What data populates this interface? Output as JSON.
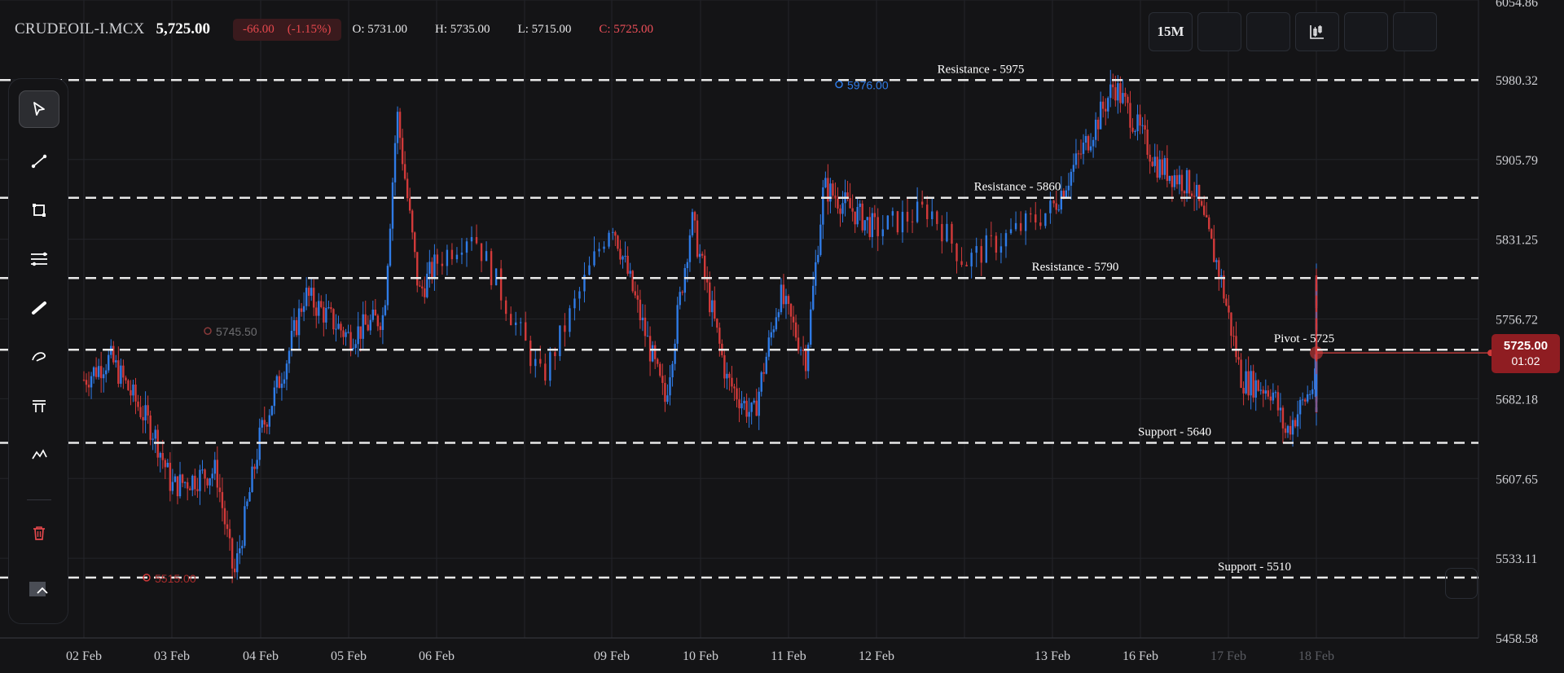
{
  "header": {
    "symbol": "CRUDEOIL-I.MCX",
    "price": "5,725.00",
    "change": "-66.00",
    "change_pct": "(-1.15%)",
    "open": "O: 5731.00",
    "high": "H: 5735.00",
    "low": "L: 5715.00",
    "close": "C: 5725.00"
  },
  "top_toolbar": {
    "interval_label": "15M",
    "buttons": [
      {
        "icon": "interval-button"
      },
      {
        "icon": "blank-button"
      },
      {
        "icon": "blank-button"
      },
      {
        "icon": "indicators-icon"
      },
      {
        "icon": "blank-button"
      },
      {
        "icon": "blank-button"
      }
    ]
  },
  "left_toolbar": {
    "tools": [
      {
        "name": "cursor",
        "icon": "cursor-arrow-icon",
        "active": true
      },
      {
        "name": "trend-line",
        "icon": "trend-line-icon"
      },
      {
        "name": "rectangle",
        "icon": "rectangle-icon"
      },
      {
        "name": "parallel-lines",
        "icon": "parallel-lines-icon"
      },
      {
        "name": "brush",
        "icon": "brush-icon"
      },
      {
        "name": "freehand",
        "icon": "freehand-icon"
      },
      {
        "name": "fibonacci",
        "icon": "fib-icon"
      },
      {
        "name": "path",
        "icon": "path-icon"
      },
      {
        "name": "delete",
        "icon": "trash-icon"
      },
      {
        "name": "collapse",
        "icon": "chevron-up-icon"
      }
    ]
  },
  "price_tag": {
    "value": "5725.00",
    "countdown": "01:02"
  },
  "colors": {
    "background": "#141416",
    "up": "#2f7be6",
    "down": "#d23a3a",
    "grid": "#232429",
    "level_line": "#e8e8e8",
    "price_line": "#b83b3b",
    "accent_red": "#e5484d"
  },
  "chart_data": {
    "type": "candlestick",
    "y_axis": {
      "ticks": [
        5458.58,
        5533.11,
        5607.65,
        5682.18,
        5756.72,
        5831.25,
        5905.79,
        5980.32,
        6054.86
      ],
      "tick_labels": [
        "5458.58",
        "5533.11",
        "5607.65",
        "5682.18",
        "5756.72",
        "5831.25",
        "5905.79",
        "5980.32",
        "6054.86"
      ],
      "range": [
        5458.58,
        6054.86
      ]
    },
    "x_axis": {
      "labels": [
        "02 Feb",
        "03 Feb",
        "04 Feb",
        "05 Feb",
        "06 Feb",
        "09 Feb",
        "10 Feb",
        "11 Feb",
        "12 Feb",
        "13 Feb",
        "16 Feb",
        "17 Feb",
        "18 Feb"
      ],
      "future_labels": [
        "17 Feb",
        "18 Feb"
      ]
    },
    "levels": [
      {
        "label": "Resistance - 5975",
        "value": 5980
      },
      {
        "label": "Resistance - 5860",
        "value": 5870
      },
      {
        "label": "Resistance - 5790",
        "value": 5795
      },
      {
        "label": "Pivot - 5725",
        "value": 5728
      },
      {
        "label": "Support - 5640",
        "value": 5641
      },
      {
        "label": "Support - 5510",
        "value": 5515
      }
    ],
    "annotations": [
      {
        "label": "5745.50",
        "value": 5745.5
      },
      {
        "label": "5976.00",
        "value": 5976.0
      },
      {
        "label": "5515.00",
        "value": 5515.0
      }
    ],
    "series_path": [
      [
        0,
        5700
      ],
      [
        0.3,
        5720
      ],
      [
        0.8,
        5650
      ],
      [
        1.0,
        5600
      ],
      [
        1.5,
        5615
      ],
      [
        1.7,
        5515
      ],
      [
        2.0,
        5650
      ],
      [
        2.3,
        5720
      ],
      [
        2.5,
        5780
      ],
      [
        3.0,
        5740
      ],
      [
        3.4,
        5760
      ],
      [
        3.55,
        5950
      ],
      [
        3.8,
        5780
      ],
      [
        4.2,
        5840
      ],
      [
        4.6,
        5700
      ],
      [
        5.0,
        5850
      ],
      [
        5.6,
        5680
      ],
      [
        5.9,
        5850
      ],
      [
        6.3,
        5700
      ],
      [
        6.6,
        5665
      ],
      [
        6.9,
        5780
      ],
      [
        7.2,
        5720
      ],
      [
        7.4,
        5880
      ],
      [
        8.0,
        5840
      ],
      [
        8.3,
        5860
      ],
      [
        8.5,
        5810
      ],
      [
        9.0,
        5860
      ],
      [
        9.5,
        5940
      ],
      [
        9.7,
        5976
      ],
      [
        10.2,
        5900
      ],
      [
        10.6,
        5880
      ],
      [
        10.9,
        5800
      ],
      [
        11.15,
        5700
      ],
      [
        11.5,
        5690
      ],
      [
        11.65,
        5650
      ],
      [
        12.0,
        5700
      ],
      [
        12.4,
        5720
      ],
      [
        12.7,
        5670
      ],
      [
        13.0,
        5710
      ],
      [
        13.3,
        5795
      ],
      [
        13.7,
        5770
      ],
      [
        13.9,
        5725
      ]
    ]
  }
}
